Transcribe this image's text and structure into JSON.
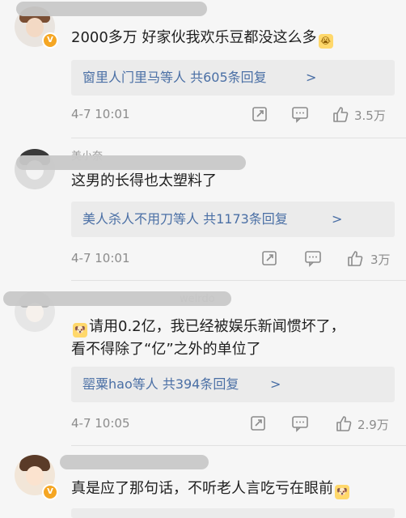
{
  "comments": [
    {
      "text": "2000多万  好家伙我欢乐豆都没这么多",
      "reply_summary": "窗里人门里马等人  共605条回复",
      "reply_chevron": ">",
      "time": "4-7  10:01",
      "likes": "3.5万"
    },
    {
      "username_partial": "美小奈",
      "text": "这男的长得也太塑料了",
      "reply_summary": "美人杀人不用刀等人  共1173条回复",
      "reply_chevron": ">",
      "time": "4-7  10:01",
      "likes": "3万"
    },
    {
      "username_partial": "weirdo",
      "text_line1": "请用0.2亿，我已经被娱乐新闻惯坏了，",
      "text_line2": "看不得除了“亿”之外的单位了",
      "reply_summary": "罂粟hao等人  共394条回复",
      "reply_chevron": ">",
      "time": "4-7  10:05",
      "likes": "2.9万"
    },
    {
      "text": "真是应了那句话，不听老人言吃亏在眼前"
    }
  ],
  "badge": "V",
  "colors": {
    "background": "#f6f6f6",
    "reply_link": "#4a6fa5",
    "meta": "#8c8c8c",
    "badge": "#f5a623"
  }
}
